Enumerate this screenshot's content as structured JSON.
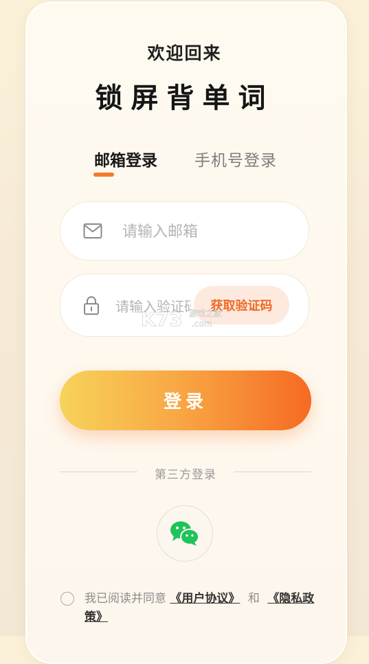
{
  "header": {
    "welcome": "欢迎回来",
    "app_title": "锁屏背单词"
  },
  "tabs": [
    {
      "label": "邮箱登录",
      "active": true
    },
    {
      "label": "手机号登录",
      "active": false
    }
  ],
  "form": {
    "email_placeholder": "请输入邮箱",
    "email_icon": "mail-icon",
    "code_placeholder": "请输入验证码",
    "code_icon": "lock-icon",
    "get_code_label": "获取验证码",
    "login_label": "登录"
  },
  "third_party": {
    "label": "第三方登录",
    "wechat_icon": "wechat-icon"
  },
  "agreement": {
    "prefix": "我已阅读并同意",
    "user_agreement": "《用户协议》",
    "and": "和",
    "privacy_policy": "《隐私政策》"
  },
  "watermark": {
    "logo": "K73",
    "site_name": "游戏之家",
    "domain": ".com"
  },
  "colors": {
    "accent": "#f47a2c",
    "button_start": "#f7d35a",
    "button_end": "#f56a22",
    "wechat_green": "#1fc35a"
  }
}
